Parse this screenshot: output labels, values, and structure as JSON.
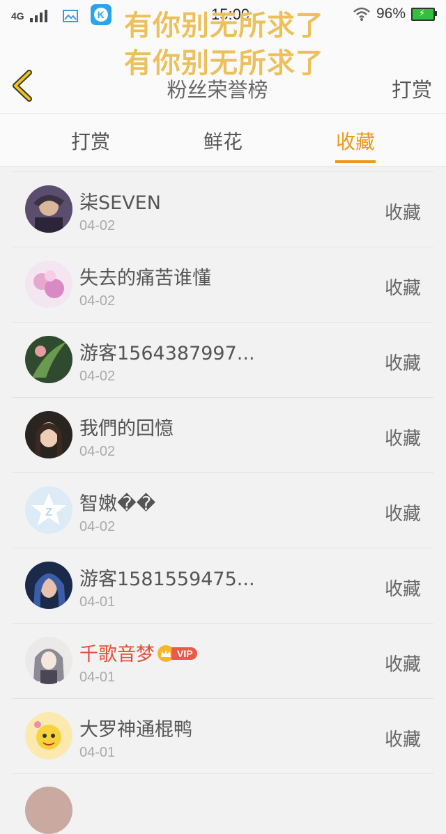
{
  "status_bar": {
    "network": "4G",
    "time": "15:00",
    "battery": "96%"
  },
  "overlay": {
    "line1": "有你别无所求了",
    "line2": "有你别无所求了"
  },
  "header": {
    "title": "粉丝荣誉榜",
    "action": "打赏"
  },
  "tabs": [
    {
      "label": "打赏"
    },
    {
      "label": "鲜花"
    },
    {
      "label": "收藏"
    }
  ],
  "active_tab_color": "#e89a1c",
  "items": [
    {
      "name": "柒SEVEN",
      "date": "04-02",
      "type": "收藏",
      "avatar": "dark-character-avatar"
    },
    {
      "name": "失去的痛苦谁懂",
      "date": "04-02",
      "type": "收藏",
      "avatar": "pink-flower-avatar"
    },
    {
      "name": "游客1564387997...",
      "date": "04-02",
      "type": "收藏",
      "avatar": "green-leaf-avatar"
    },
    {
      "name": "我們的回憶",
      "date": "04-02",
      "type": "收藏",
      "avatar": "woman-portrait-avatar"
    },
    {
      "name": "智嫩��",
      "date": "04-02",
      "type": "收藏",
      "avatar": "default-star-avatar"
    },
    {
      "name": "游客1581559475...",
      "date": "04-01",
      "type": "收藏",
      "avatar": "blue-hair-avatar"
    },
    {
      "name": "千歌音梦",
      "date": "04-01",
      "type": "收藏",
      "avatar": "anime-girl-avatar",
      "vip": "VIP",
      "vip_color": "#e0503a"
    },
    {
      "name": "大罗神通棍鸭",
      "date": "04-01",
      "type": "收藏",
      "avatar": "yellow-cartoon-avatar"
    }
  ]
}
